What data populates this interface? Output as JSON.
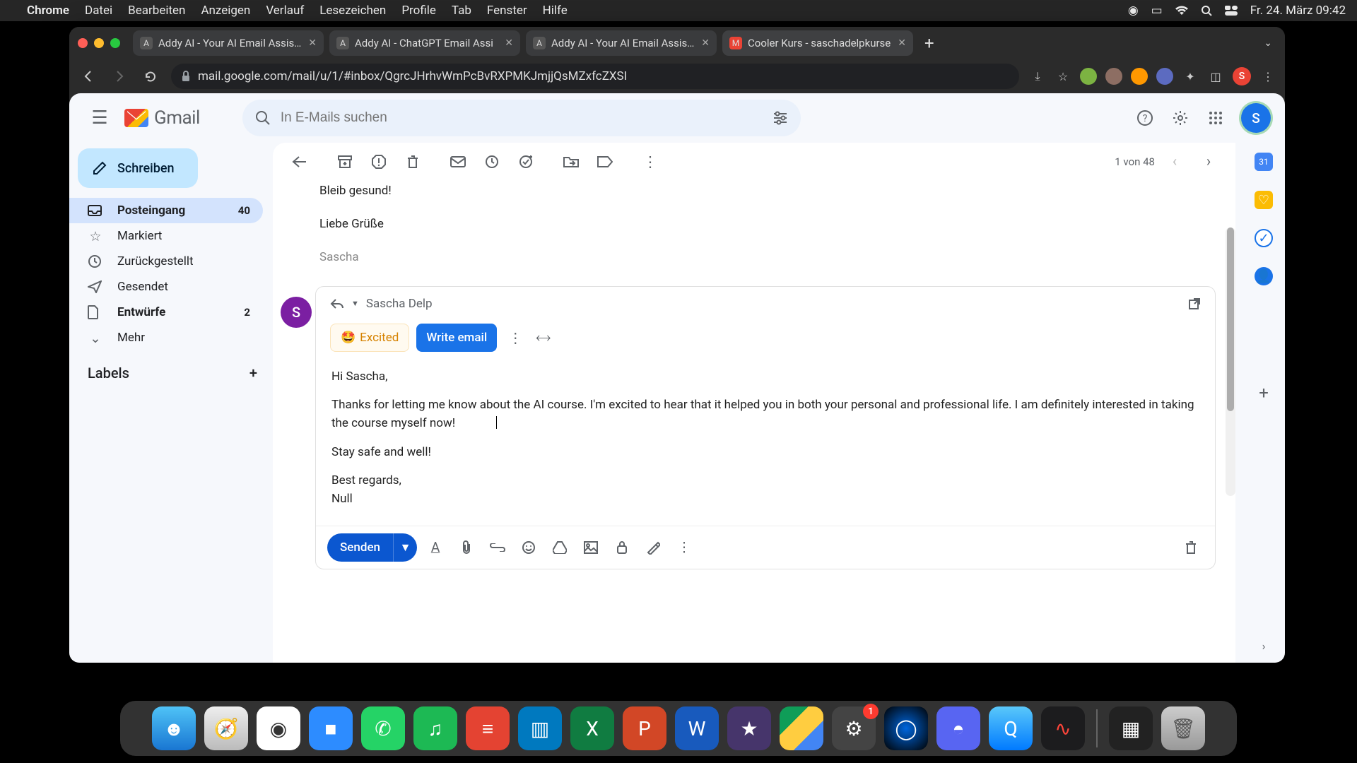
{
  "menubar": {
    "app": "Chrome",
    "items": [
      "Datei",
      "Bearbeiten",
      "Anzeigen",
      "Verlauf",
      "Lesezeichen",
      "Profile",
      "Tab",
      "Fenster",
      "Hilfe"
    ],
    "clock": "Fr. 24. März  09:42"
  },
  "tabs": [
    {
      "title": "Addy AI - Your AI Email Assista"
    },
    {
      "title": "Addy AI - ChatGPT Email Assi"
    },
    {
      "title": "Addy AI - Your AI Email Assista"
    },
    {
      "title": "Cooler Kurs - saschadelpkurse"
    }
  ],
  "url": "mail.google.com/mail/u/1/#inbox/QgrcJHrhvWmPcBvRXPMKJmjjQsMZxfcZXSI",
  "gmail": {
    "brand": "Gmail",
    "search_placeholder": "In E-Mails suchen",
    "compose": "Schreiben",
    "nav": [
      {
        "icon": "inbox",
        "label": "Posteingang",
        "count": "40",
        "active": true,
        "bold": true
      },
      {
        "icon": "star",
        "label": "Markiert"
      },
      {
        "icon": "snooze",
        "label": "Zurückgestellt"
      },
      {
        "icon": "send",
        "label": "Gesendet"
      },
      {
        "icon": "draft",
        "label": "Entwürfe",
        "count": "2",
        "bold": true
      },
      {
        "icon": "more",
        "label": "Mehr"
      }
    ],
    "labels_header": "Labels",
    "pager": "1 von 48",
    "avatar_letter": "S"
  },
  "prev_message": {
    "line1": "Bleib gesund!",
    "line2": "Liebe Grüße",
    "sig": "Sascha"
  },
  "compose": {
    "to_name": "Sascha Delp",
    "chip_excited": "Excited",
    "chip_write": "Write email",
    "body": {
      "greeting": "Hi Sascha,",
      "p1": "Thanks for letting me know about the AI course. I'm excited to hear that it helped you in both your personal and professional life. I am definitely interested in taking the course myself now!",
      "p2": "Stay safe and well!",
      "closing": "Best regards,",
      "name": "Null"
    },
    "send": "Senden"
  },
  "rail_cal": "31",
  "dock_badge": "1"
}
